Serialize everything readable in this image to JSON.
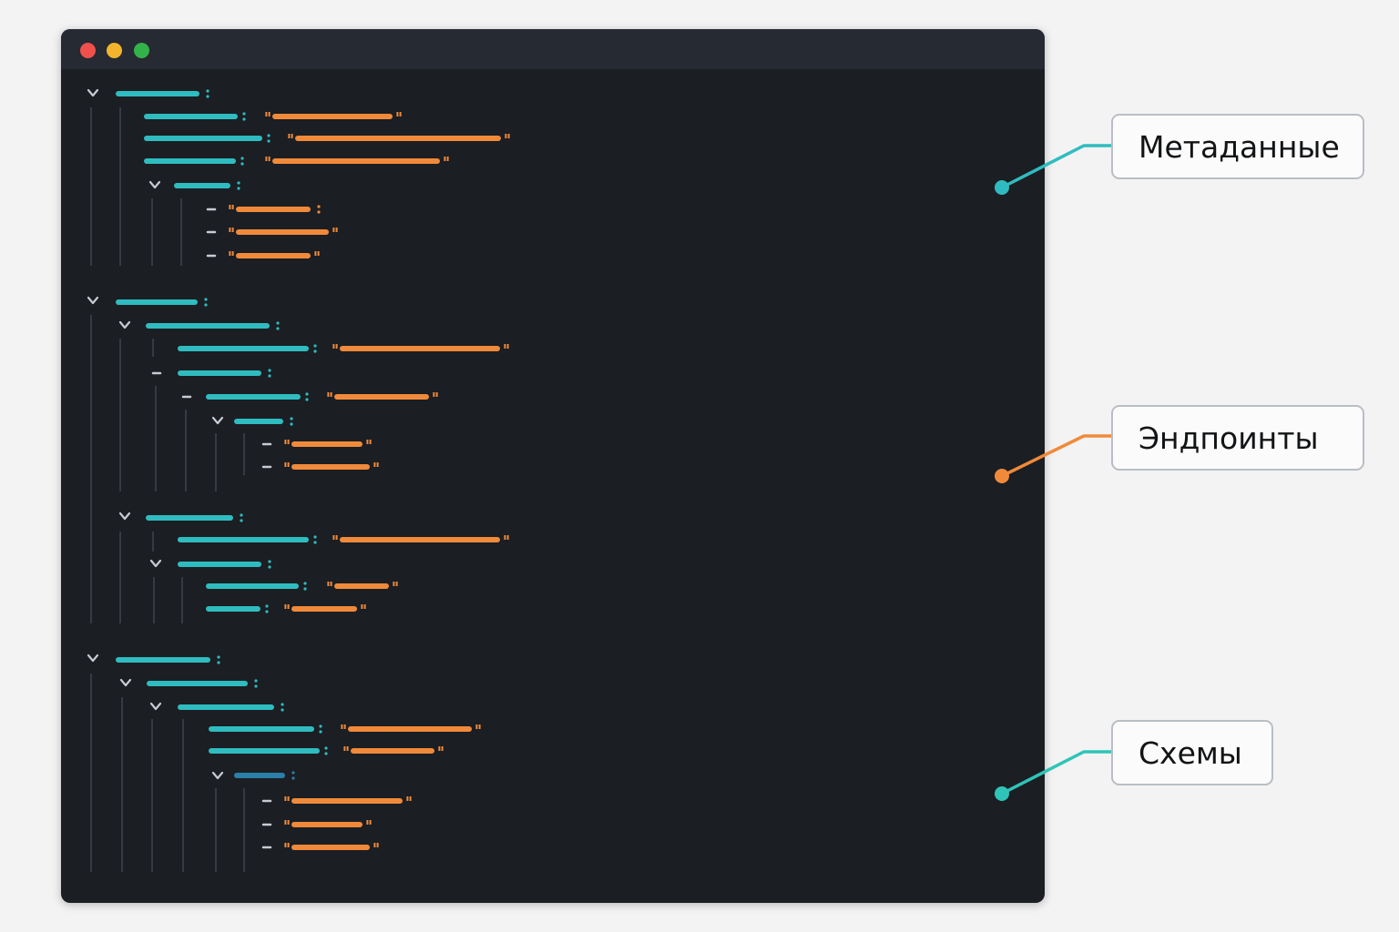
{
  "colors": {
    "key": "#2fbcc0",
    "string": "#f08a3a",
    "punct": "#c8ccd2",
    "guide": "#3d4249",
    "nested_key": "#2b7fa8"
  },
  "window": {
    "controls": [
      "close",
      "minimize",
      "maximize"
    ]
  },
  "callouts": [
    {
      "id": "metadata",
      "label": "Метаданные",
      "color": "#2fbcc0"
    },
    {
      "id": "endpoints",
      "label": "Эндпоинты",
      "color": "#f08a3a"
    },
    {
      "id": "schemas",
      "label": "Схемы",
      "color": "#2fbcc0"
    }
  ]
}
